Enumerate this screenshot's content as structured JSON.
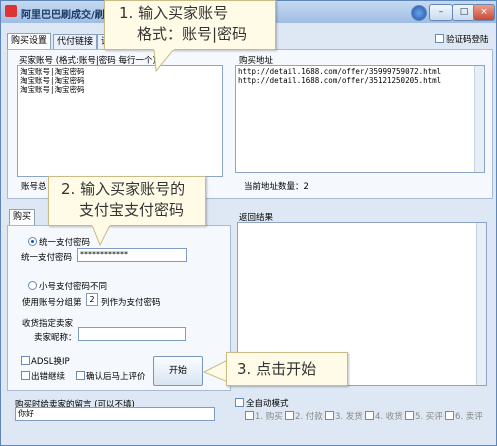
{
  "window": {
    "title": "阿里巴巴刷成交/刷销量"
  },
  "topright": {
    "verify_login": "验证码登陆"
  },
  "tabs": [
    "购买设置",
    "代付链接",
    "评"
  ],
  "buyer_accounts": {
    "label": "买家账号 (格式:账号|密码 每行一个)",
    "lines": [
      "淘宝账号|淘宝密码",
      "淘宝账号|淘宝密码",
      "淘宝账号|淘宝密码"
    ],
    "count_label": "账号总"
  },
  "purchase_urls": {
    "label": "购买地址",
    "lines": [
      "http://detail.1688.com/offer/35999759072.html",
      "http://detail.1688.com/offer/35121250205.html"
    ],
    "count_label": "当前地址数量：",
    "count": "2"
  },
  "buy_tab": "购买",
  "payment": {
    "unified_label": "统一支付密码",
    "unified_field_label": "统一支付密码",
    "unified_value": "************",
    "different_label": "小号支付密码不同",
    "group_prefix": "使用账号分组第",
    "group_value": "2",
    "group_suffix": "列作为支付密码"
  },
  "seller": {
    "section_label": "收货指定卖家",
    "nick_label": "卖家昵称："
  },
  "options": {
    "adsl": "ADSL换IP",
    "skip_error": "出错继续",
    "confirm_review": "确认后马上评价",
    "start": "开始"
  },
  "result": {
    "label": "返回结果"
  },
  "message": {
    "label": "购买时给卖家的留言 (可以不填)",
    "value": "你好"
  },
  "auto_mode": {
    "label": "全自动模式",
    "steps": [
      "1. 购买",
      "2. 付款",
      "3. 发货",
      "4. 收货",
      "5. 买评",
      "6. 卖评"
    ]
  },
  "callouts": {
    "c1_line1": "1. 输入买家账号",
    "c1_line2": "格式：账号|密码",
    "c2_line1": "2. 输入买家账号的",
    "c2_line2": "支付宝支付密码",
    "c3": "3. 点击开始"
  },
  "colors": {
    "callout_bg": "#fffbe6",
    "window_bg": "#dde8f4"
  }
}
